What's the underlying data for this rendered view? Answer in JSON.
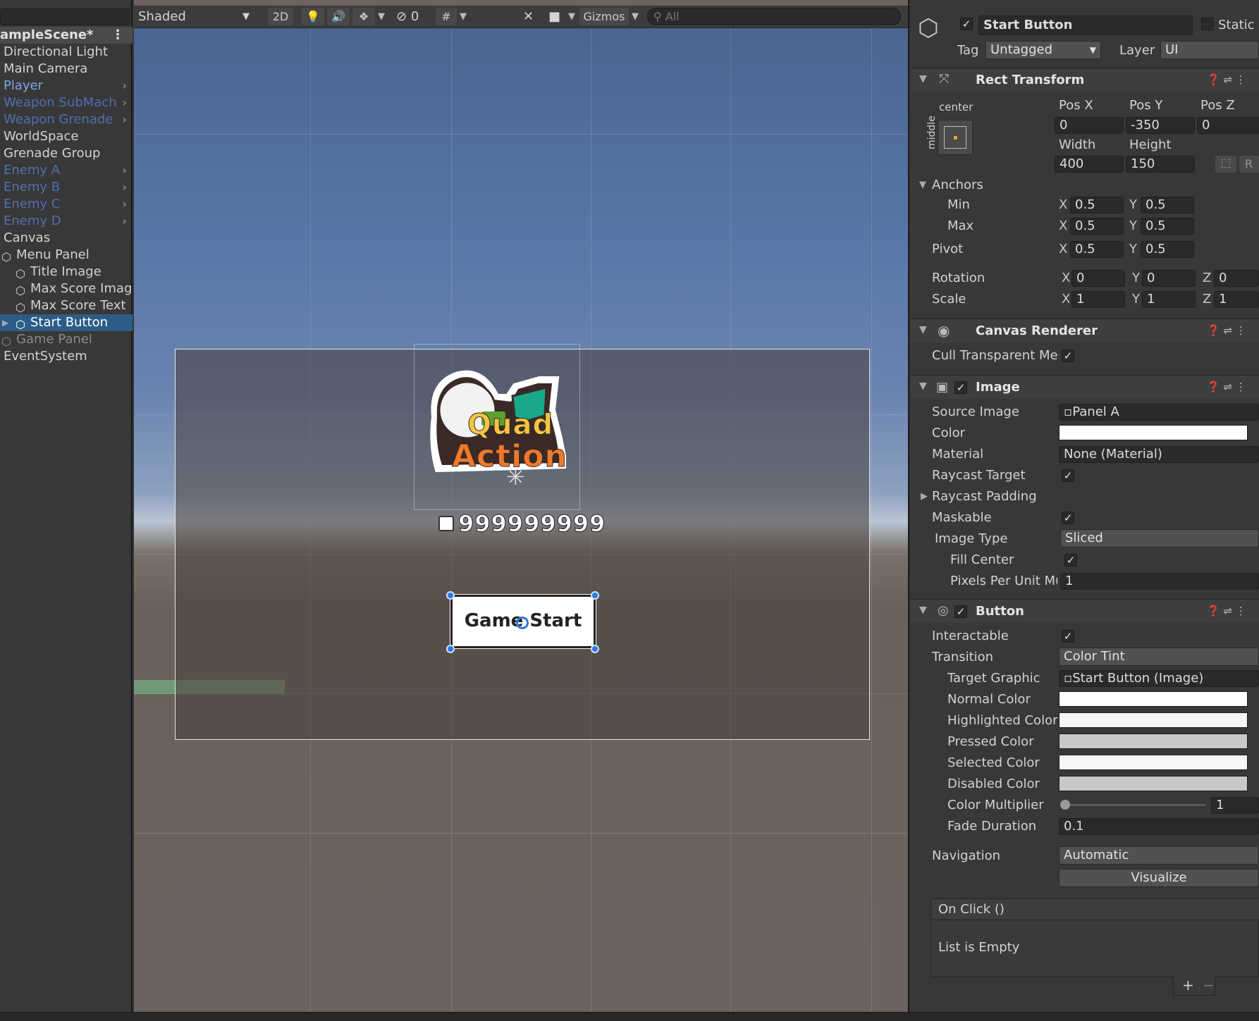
{
  "hierarchy": {
    "scene_name": "ampleScene*",
    "items": [
      {
        "label": "Directional Light",
        "style": "",
        "arrow": false
      },
      {
        "label": "Main Camera",
        "style": "",
        "arrow": false
      },
      {
        "label": "Player",
        "style": "blue",
        "arrow": true
      },
      {
        "label": "Weapon SubMach",
        "style": "dimblue",
        "arrow": true
      },
      {
        "label": "Weapon Grenade",
        "style": "dimblue",
        "arrow": true
      },
      {
        "label": "WorldSpace",
        "style": "",
        "arrow": false
      },
      {
        "label": "Grenade Group",
        "style": "",
        "arrow": false
      },
      {
        "label": "Enemy A",
        "style": "dimblue",
        "arrow": true
      },
      {
        "label": "Enemy B",
        "style": "dimblue",
        "arrow": true
      },
      {
        "label": "Enemy C",
        "style": "dimblue",
        "arrow": true
      },
      {
        "label": "Enemy D",
        "style": "dimblue",
        "arrow": true
      },
      {
        "label": "Canvas",
        "style": "",
        "arrow": false
      },
      {
        "label": "Menu Panel",
        "style": "",
        "arrow": false
      },
      {
        "label": "Title Image",
        "style": "",
        "arrow": false
      },
      {
        "label": "Max Score Imag",
        "style": "",
        "arrow": false
      },
      {
        "label": "Max Score Text",
        "style": "",
        "arrow": false
      },
      {
        "label": "Start Button",
        "style": "sel",
        "arrow": false
      },
      {
        "label": "Game Panel",
        "style": "dim",
        "arrow": false
      },
      {
        "label": "EventSystem",
        "style": "",
        "arrow": false
      }
    ]
  },
  "scene": {
    "shading_mode": "Shaded",
    "mode_2d": "2D",
    "hidden_count": "0",
    "gizmos": "Gizmos",
    "search_placeholder": "All",
    "logo_line1": "Quad",
    "logo_line2": "Action",
    "max_score": "999999999",
    "button_text": "Game Start"
  },
  "inspector": {
    "object_name": "Start Button",
    "static_label": "Static",
    "tag_label": "Tag",
    "tag_value": "Untagged",
    "layer_label": "Layer",
    "layer_value": "UI",
    "rect": {
      "title": "Rect Transform",
      "anchor_h": "center",
      "anchor_v": "middle",
      "posx_label": "Pos X",
      "posx": "0",
      "posy_label": "Pos Y",
      "posy": "-350",
      "posz_label": "Pos Z",
      "posz": "0",
      "width_label": "Width",
      "width": "400",
      "height_label": "Height",
      "height": "150",
      "r_btn": "R",
      "anchors": "Anchors",
      "min": "Min",
      "min_x": "0.5",
      "min_y": "0.5",
      "max": "Max",
      "max_x": "0.5",
      "max_y": "0.5",
      "pivot": "Pivot",
      "pivot_x": "0.5",
      "pivot_y": "0.5",
      "rotation": "Rotation",
      "rot_x": "0",
      "rot_y": "0",
      "rot_z": "0",
      "scale": "Scale",
      "scale_x": "1",
      "scale_y": "1",
      "scale_z": "1"
    },
    "canvas_renderer": {
      "title": "Canvas Renderer",
      "cull": "Cull Transparent Me"
    },
    "image": {
      "title": "Image",
      "source_image": "Source Image",
      "source_value": "Panel A",
      "color": "Color",
      "material": "Material",
      "material_value": "None (Material)",
      "raycast_target": "Raycast Target",
      "raycast_padding": "Raycast Padding",
      "maskable": "Maskable",
      "image_type": "Image Type",
      "image_type_value": "Sliced",
      "fill_center": "Fill Center",
      "ppu": "Pixels Per Unit Mu",
      "ppu_value": "1"
    },
    "button": {
      "title": "Button",
      "interactable": "Interactable",
      "transition": "Transition",
      "transition_value": "Color Tint",
      "target_graphic": "Target Graphic",
      "target_value": "Start Button (Image)",
      "normal": "Normal Color",
      "highlighted": "Highlighted Color",
      "pressed": "Pressed Color",
      "selected": "Selected Color",
      "disabled": "Disabled Color",
      "multiplier": "Color Multiplier",
      "multiplier_value": "1",
      "fade": "Fade Duration",
      "fade_value": "0.1",
      "navigation": "Navigation",
      "navigation_value": "Automatic",
      "visualize": "Visualize",
      "onclick": "On Click ()",
      "empty": "List is Empty",
      "plus": "+",
      "minus": "−"
    },
    "colors": {
      "normal": "#ffffff",
      "highlighted": "#f5f5f5",
      "pressed": "#c8c8c8",
      "selected": "#f5f5f5",
      "disabled": "#c8c8c8"
    }
  }
}
